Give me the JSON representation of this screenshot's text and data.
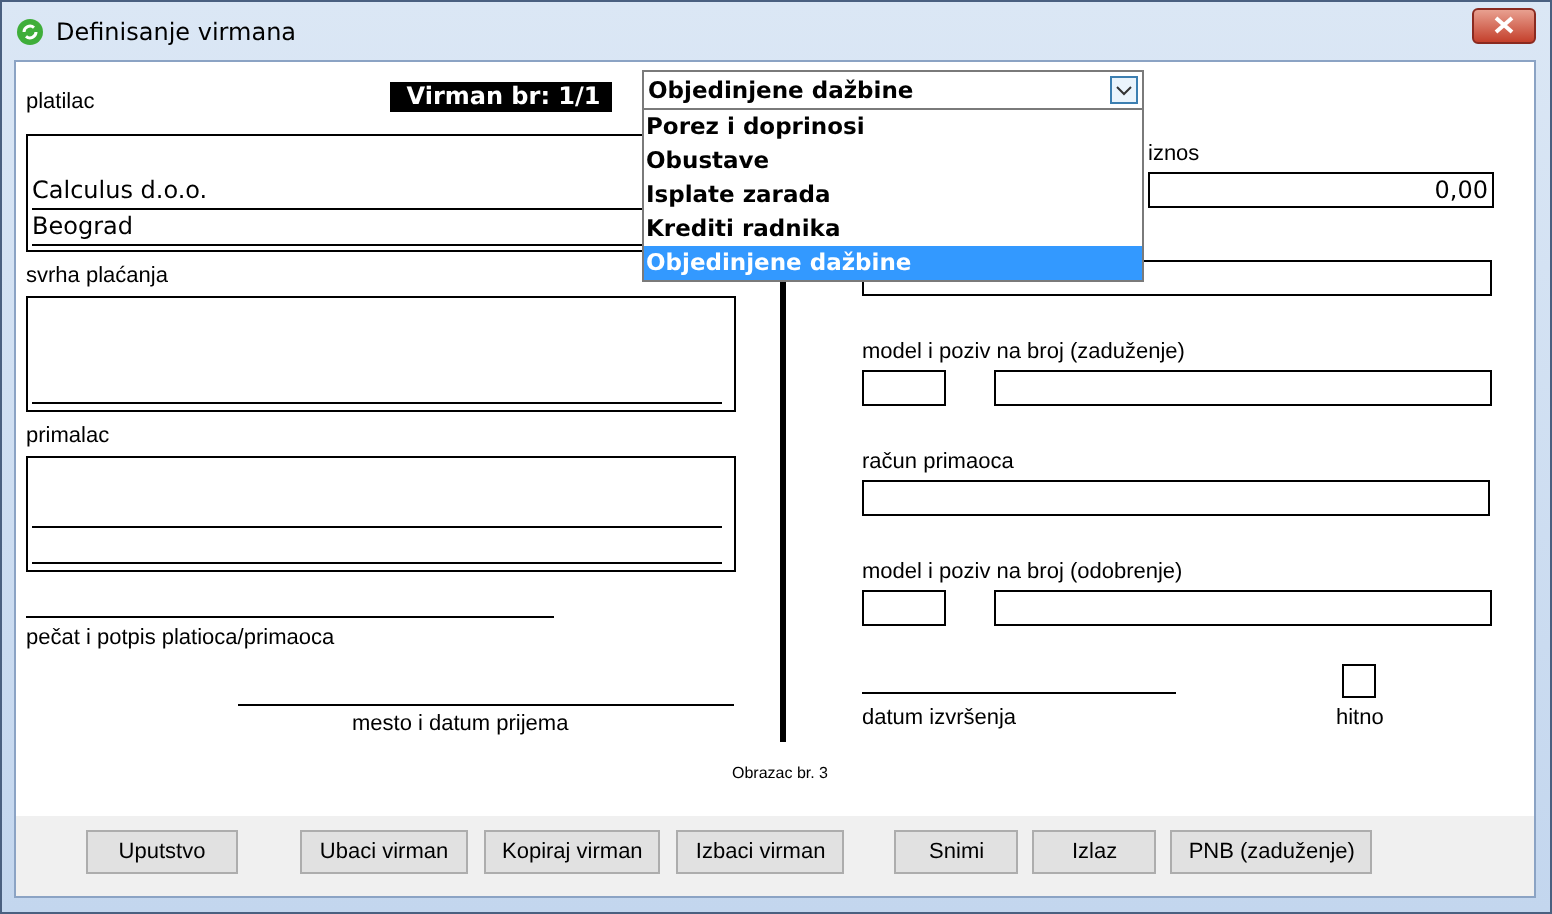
{
  "window": {
    "title": "Definisanje virmana"
  },
  "header": {
    "number_label": "Virman br: 1/1"
  },
  "type_dropdown": {
    "value": "Objedinjene dažbine",
    "expanded": true,
    "options": [
      {
        "label": "Porez i doprinosi",
        "selected": false
      },
      {
        "label": "Obustave",
        "selected": false
      },
      {
        "label": "Isplate zarada",
        "selected": false
      },
      {
        "label": "Krediti radnika",
        "selected": false
      },
      {
        "label": "Objedinjene dažbine",
        "selected": true
      }
    ]
  },
  "payer": {
    "label": "platilac",
    "lines": [
      "Calculus d.o.o.",
      "Beograd"
    ]
  },
  "purpose": {
    "label": "svrha plaćanja"
  },
  "recipient": {
    "label": "primalac"
  },
  "signature": {
    "label": "pečat i potpis platioca/primaoca"
  },
  "receipt": {
    "label": "mesto i datum prijema"
  },
  "amount": {
    "label": "iznos",
    "value": "0,00"
  },
  "debit_reference": {
    "label": "model i poziv na broj (zaduženje)"
  },
  "recipient_account": {
    "label": "račun primaoca"
  },
  "credit_reference": {
    "label": "model i poziv na broj (odobrenje)"
  },
  "execution_date": {
    "label": "datum izvršenja"
  },
  "urgent": {
    "label": "hitno",
    "checked": false
  },
  "form_number": "Obrazac br. 3",
  "buttons": [
    {
      "label": "Uputstvo"
    },
    {
      "label": "Ubaci virman"
    },
    {
      "label": "Kopiraj virman"
    },
    {
      "label": "Izbaci virman"
    },
    {
      "label": "Snimi"
    },
    {
      "label": "Izlaz"
    },
    {
      "label": "PNB (zaduženje)"
    }
  ]
}
